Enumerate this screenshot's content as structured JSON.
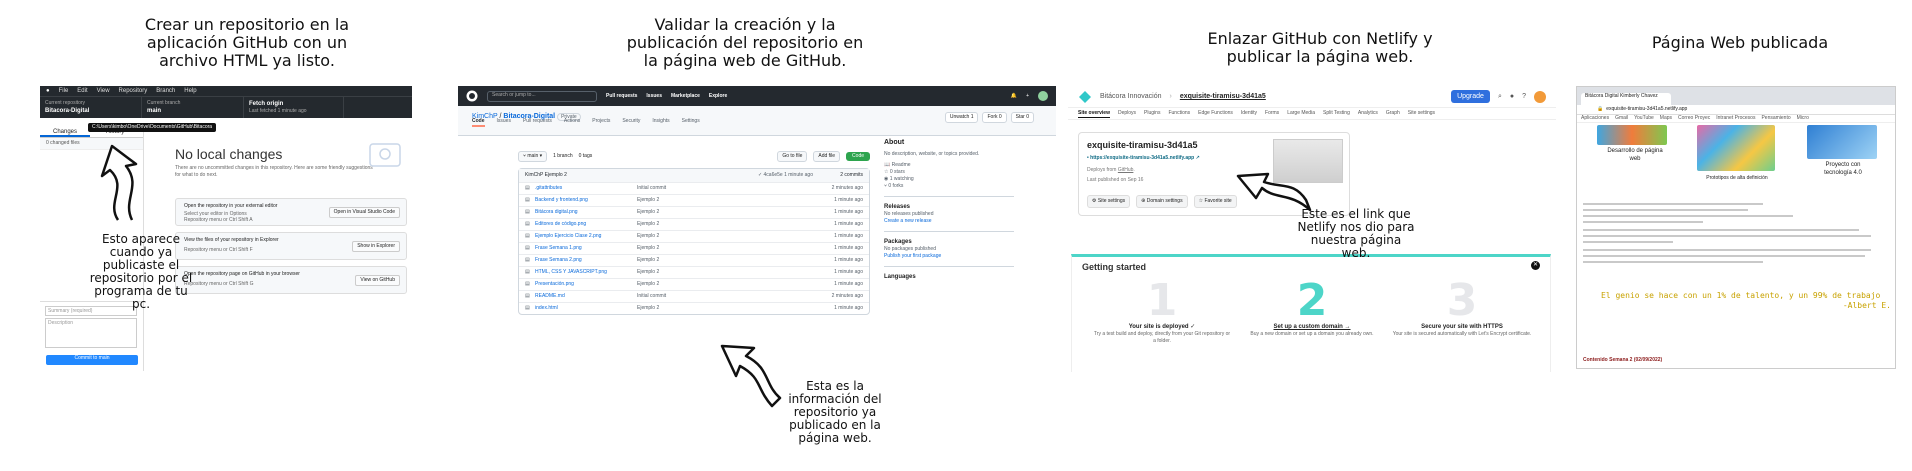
{
  "captions": {
    "c1": "Crear un repositorio en la aplicación GitHub con un archivo HTML ya listo.",
    "c2": "Validar la creación y la publicación del repositorio en la página web de GitHub.",
    "c3": "Enlazar GitHub con Netlify y publicar la página web.",
    "c4": "Página Web publicada"
  },
  "notes": {
    "n1": "Esto aparece cuando ya publicaste el repositorio por el programa de tu pc.",
    "n2": "Esta es la información del repositorio ya publicado en la página web.",
    "n3": "Este es el link que Netlify nos dio para nuestra página web."
  },
  "desktop": {
    "menu": [
      "File",
      "Edit",
      "View",
      "Repository",
      "Branch",
      "Help"
    ],
    "repo_label": "Current repository",
    "repo_value": "Bitacora-Digital",
    "branch_label": "Current branch",
    "branch_value": "main",
    "fetch_label": "Fetch origin",
    "fetch_sub": "Last fetched 1 minute ago",
    "tab_changes": "Changes",
    "tab_history": "History",
    "tooltip": "C:\\Users\\kimbo\\OneDrive\\Documents\\GitHub\\Bitacora",
    "changed_files": "0 changed files",
    "title": "No local changes",
    "subtitle": "There are no uncommitted changes in this repository. Here are some friendly suggestions for what to do next.",
    "cards": [
      {
        "title": "Open the repository in your external editor",
        "sub": "Select your editor in Options",
        "hint": "Repository menu or Ctrl Shift A",
        "button": "Open in Visual Studio Code"
      },
      {
        "title": "View the files of your repository in Explorer",
        "sub": "",
        "hint": "Repository menu or Ctrl Shift F",
        "button": "Show in Explorer"
      },
      {
        "title": "Open the repository page on GitHub in your browser",
        "sub": "",
        "hint": "Repository menu or Ctrl Shift G",
        "button": "View on GitHub"
      }
    ],
    "summary_placeholder": "Summary (required)",
    "description_placeholder": "Description",
    "commit_button": "Commit to main"
  },
  "github": {
    "search_placeholder": "Search or jump to...",
    "nav": [
      "Pull requests",
      "Issues",
      "Marketplace",
      "Explore"
    ],
    "owner": "KimChP",
    "repo": "Bitacora-Digital",
    "visibility": "Private",
    "repo_actions": [
      "Unwatch 1",
      "Fork 0",
      "Star 0"
    ],
    "tabs": [
      "Code",
      "Issues",
      "Pull requests",
      "Actions",
      "Projects",
      "Security",
      "Insights",
      "Settings"
    ],
    "branch": "main",
    "branches": "1 branch",
    "tags": "0 tags",
    "btn_goto": "Go to file",
    "btn_add": "Add file",
    "btn_code": "Code",
    "commit_author": "KimChP Ejemplo 2",
    "commit_meta": "✓ 4ca6e5e 1 minute ago",
    "commit_count": "2 commits",
    "files": [
      {
        "name": ".gitattributes",
        "msg": "Initial commit",
        "time": "2 minutes ago"
      },
      {
        "name": "Backend y frontend.png",
        "msg": "Ejemplo 2",
        "time": "1 minute ago"
      },
      {
        "name": "Bitácora digital.png",
        "msg": "Ejemplo 2",
        "time": "1 minute ago"
      },
      {
        "name": "Editores de código.png",
        "msg": "Ejemplo 2",
        "time": "1 minute ago"
      },
      {
        "name": "Ejemplo Ejercicio Clase 2.png",
        "msg": "Ejemplo 2",
        "time": "1 minute ago"
      },
      {
        "name": "Frase Semana 1.png",
        "msg": "Ejemplo 2",
        "time": "1 minute ago"
      },
      {
        "name": "Frase Semana 2.png",
        "msg": "Ejemplo 2",
        "time": "1 minute ago"
      },
      {
        "name": "HTML, CSS Y JAVASCRIPT.png",
        "msg": "Ejemplo 2",
        "time": "1 minute ago"
      },
      {
        "name": "Presentación.png",
        "msg": "Ejemplo 2",
        "time": "1 minute ago"
      },
      {
        "name": "README.md",
        "msg": "Initial commit",
        "time": "2 minutes ago"
      },
      {
        "name": "index.html",
        "msg": "Ejemplo 2",
        "time": "1 minute ago"
      }
    ],
    "about_title": "About",
    "about_desc": "No description, website, or topics provided.",
    "about_items": [
      "Readme",
      "0 stars",
      "1 watching",
      "0 forks"
    ],
    "releases_title": "Releases",
    "releases_desc": "No releases published",
    "releases_link": "Create a new release",
    "packages_title": "Packages",
    "packages_desc": "No packages published",
    "packages_link": "Publish your first package",
    "languages_title": "Languages"
  },
  "netlify": {
    "team": "Bitácora Innovación",
    "site": "exquisite-tiramisu-3d41a5",
    "upgrade": "Upgrade",
    "nav": [
      "Site overview",
      "Deploys",
      "Plugins",
      "Functions",
      "Edge Functions",
      "Identity",
      "Forms",
      "Large Media",
      "Split Testing",
      "Analytics",
      "Graph",
      "Site settings"
    ],
    "site_title": "exquisite-tiramisu-3d41a5",
    "site_url": "https://exquisite-tiramisu-3d41a5.netlify.app",
    "deploys_from": "Deploys from",
    "deploys_source": "GitHub",
    "published": "Last published on Sep 16",
    "buttons": [
      "Site settings",
      "Domain settings",
      "Favorite site"
    ],
    "started_title": "Getting started",
    "steps": [
      {
        "num": "1",
        "title": "Your site is deployed ✓",
        "desc": "Try a test build and deploy, directly from your Git repository or a folder."
      },
      {
        "num": "2",
        "title": "Set up a custom domain →",
        "desc": "Buy a new domain or set up a domain you already own."
      },
      {
        "num": "3",
        "title": "Secure your site with HTTPS",
        "desc": "Your site is secured automatically with Let's Encrypt certificate."
      }
    ]
  },
  "published": {
    "tab_title": "Bitácora Digital Kimberly Chavez",
    "url": "exquisite-tiramisu-3d41a5.netlify.app",
    "bookmarks": [
      "Aplicaciones",
      "Gmail",
      "YouTube",
      "Maps",
      "Correo Proyec",
      "Intranet Procesos",
      "Pensamiento",
      "Micro"
    ],
    "label_a": "Desarrollo de página web",
    "label_b": "Prototipos de alta definición",
    "label_c": "Proyecto con tecnología 4.0",
    "quote_line1": "El genio se hace con un 1% de talento, y un 99% de trabajo",
    "quote_line2": "-Albert E.",
    "footer_heading": "Contenido Semana 2 (02/09/2022)",
    "colors": {
      "quote": "#c8a200",
      "link": "#0969da",
      "green": "#2da44e",
      "netlify_teal": "#4dd5c8"
    }
  }
}
